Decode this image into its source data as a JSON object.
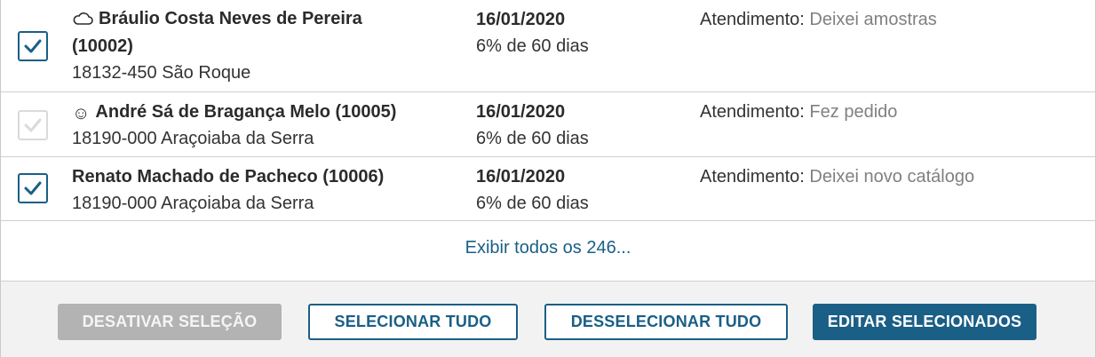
{
  "rows": [
    {
      "checked": true,
      "disabled": false,
      "icon": "cloud-icon",
      "name": "Bráulio Costa Neves de Pereira",
      "code": "(10002)",
      "address": "18132-450 São Roque",
      "date": "16/01/2020",
      "terms": "6% de 60 dias",
      "attendance_label": "Atendimento:",
      "attendance_value": "Deixei amostras"
    },
    {
      "checked": true,
      "disabled": true,
      "icon": "smiley-icon",
      "name": "André Sá de Bragança Melo (10005)",
      "address": "18190-000 Araçoiaba da Serra",
      "date": "16/01/2020",
      "terms": "6% de 60 dias",
      "attendance_label": "Atendimento:",
      "attendance_value": "Fez pedido"
    },
    {
      "checked": true,
      "disabled": false,
      "icon": null,
      "name": "Renato Machado de Pacheco (10006)",
      "address": "18190-000 Araçoiaba da Serra",
      "date": "16/01/2020",
      "terms": "6% de 60 dias",
      "attendance_label": "Atendimento:",
      "attendance_value": "Deixei novo catálogo"
    }
  ],
  "show_all_link": "Exibir todos os 246...",
  "buttons": {
    "deactivate": "DESATIVAR SELEÇÃO",
    "select_all": "SELECIONAR TUDO",
    "deselect_all": "DESSELECIONAR TUDO",
    "edit_selected": "EDITAR SELECIONADOS"
  },
  "colors": {
    "accent": "#1a5f86",
    "disabled_button": "#b3b3b3",
    "muted_text": "#808080"
  }
}
